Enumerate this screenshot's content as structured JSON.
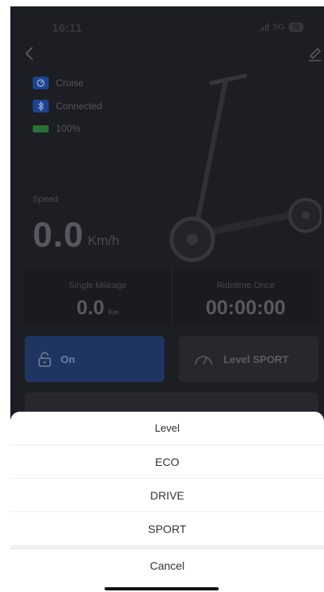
{
  "status_bar": {
    "time": "16:11",
    "network": "5G",
    "battery": "76"
  },
  "info": [
    {
      "label": "Cruise",
      "icon": "cruise-icon"
    },
    {
      "label": "Connected",
      "icon": "bluetooth-icon"
    },
    {
      "label": "100%",
      "icon": "battery-icon"
    }
  ],
  "speed": {
    "label": "Speed",
    "value": "0.0",
    "unit": "Km/h"
  },
  "stats": {
    "single_mileage": {
      "label": "Single Mileage",
      "value": "0.0",
      "unit": "Km"
    },
    "ridetime_once": {
      "label": "Ridetime Once",
      "value": "00:00:00"
    }
  },
  "controls": {
    "lock_label": "On",
    "level_label": "Level SPORT"
  },
  "sheet": {
    "title": "Level",
    "options": [
      "ECO",
      "DRIVE",
      "SPORT"
    ],
    "cancel": "Cancel"
  },
  "colors": {
    "accent": "#223a6a",
    "background": "#1f2126",
    "sheet": "#ffffff"
  }
}
